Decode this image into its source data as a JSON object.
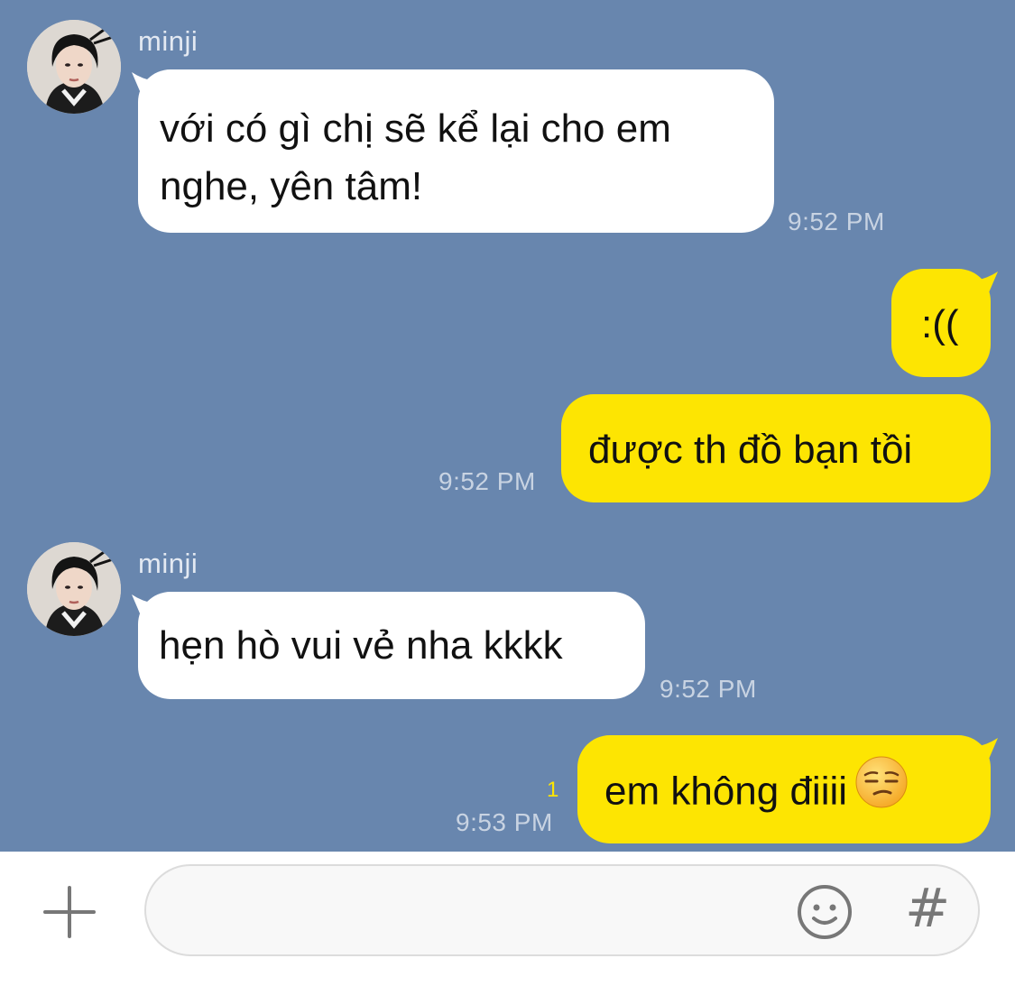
{
  "messages": [
    {
      "sender": "minji",
      "text_lines": [
        "với có gì chị sẽ kể lại cho em",
        "nghe, yên tâm!"
      ],
      "time": "9:52 PM"
    },
    {
      "text": ":((",
      "outgoing": true
    },
    {
      "text": "được th đồ bạn tồi",
      "time": "9:52 PM",
      "outgoing": true
    },
    {
      "sender": "minji",
      "text": "hẹn hò vui vẻ nha kkkk",
      "time": "9:52 PM"
    },
    {
      "text": "em không điiii",
      "emoji": "unamused-face",
      "time": "9:53 PM",
      "unread_count": "1",
      "outgoing": true
    }
  ],
  "composer": {
    "add_icon": "plus-icon",
    "emoji_icon": "smiley-icon",
    "hashtag_label": "#"
  },
  "colors": {
    "chat_background": "#6886ae",
    "outgoing_bubble": "#fde502",
    "incoming_bubble": "#ffffff"
  }
}
